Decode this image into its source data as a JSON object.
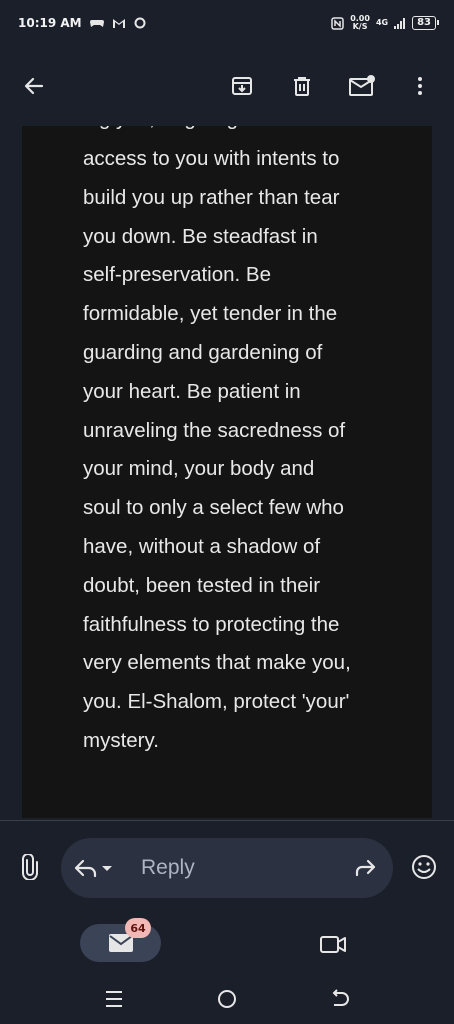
{
  "status_bar": {
    "time": "10:19 AM",
    "net_speed_value": "0.00",
    "net_speed_unit": "K/S",
    "network_type": "4G",
    "battery": "83"
  },
  "email": {
    "clipped_line": "ing you, forgiving the",
    "body_lines": [
      "access to you with intents to",
      "build you up rather than tear",
      "you down. Be steadfast in",
      "self-preservation. Be",
      "formidable, yet tender in the",
      "guarding and gardening of",
      "your heart. Be patient in",
      "unraveling the sacredness of",
      "your mind, your body and",
      "soul to only a select few who",
      "have, without a shadow of",
      "doubt, been tested in their",
      "faithfulness to protecting the",
      "very elements that make you,",
      "you. El-Shalom, protect 'your'",
      "mystery."
    ]
  },
  "reply": {
    "placeholder": "Reply"
  },
  "bottom_nav": {
    "mail_badge": "64"
  },
  "colors": {
    "background": "#1b1f2a",
    "card": "#141414",
    "reply_pill": "#2b3141",
    "badge": "#f2b8b5"
  }
}
